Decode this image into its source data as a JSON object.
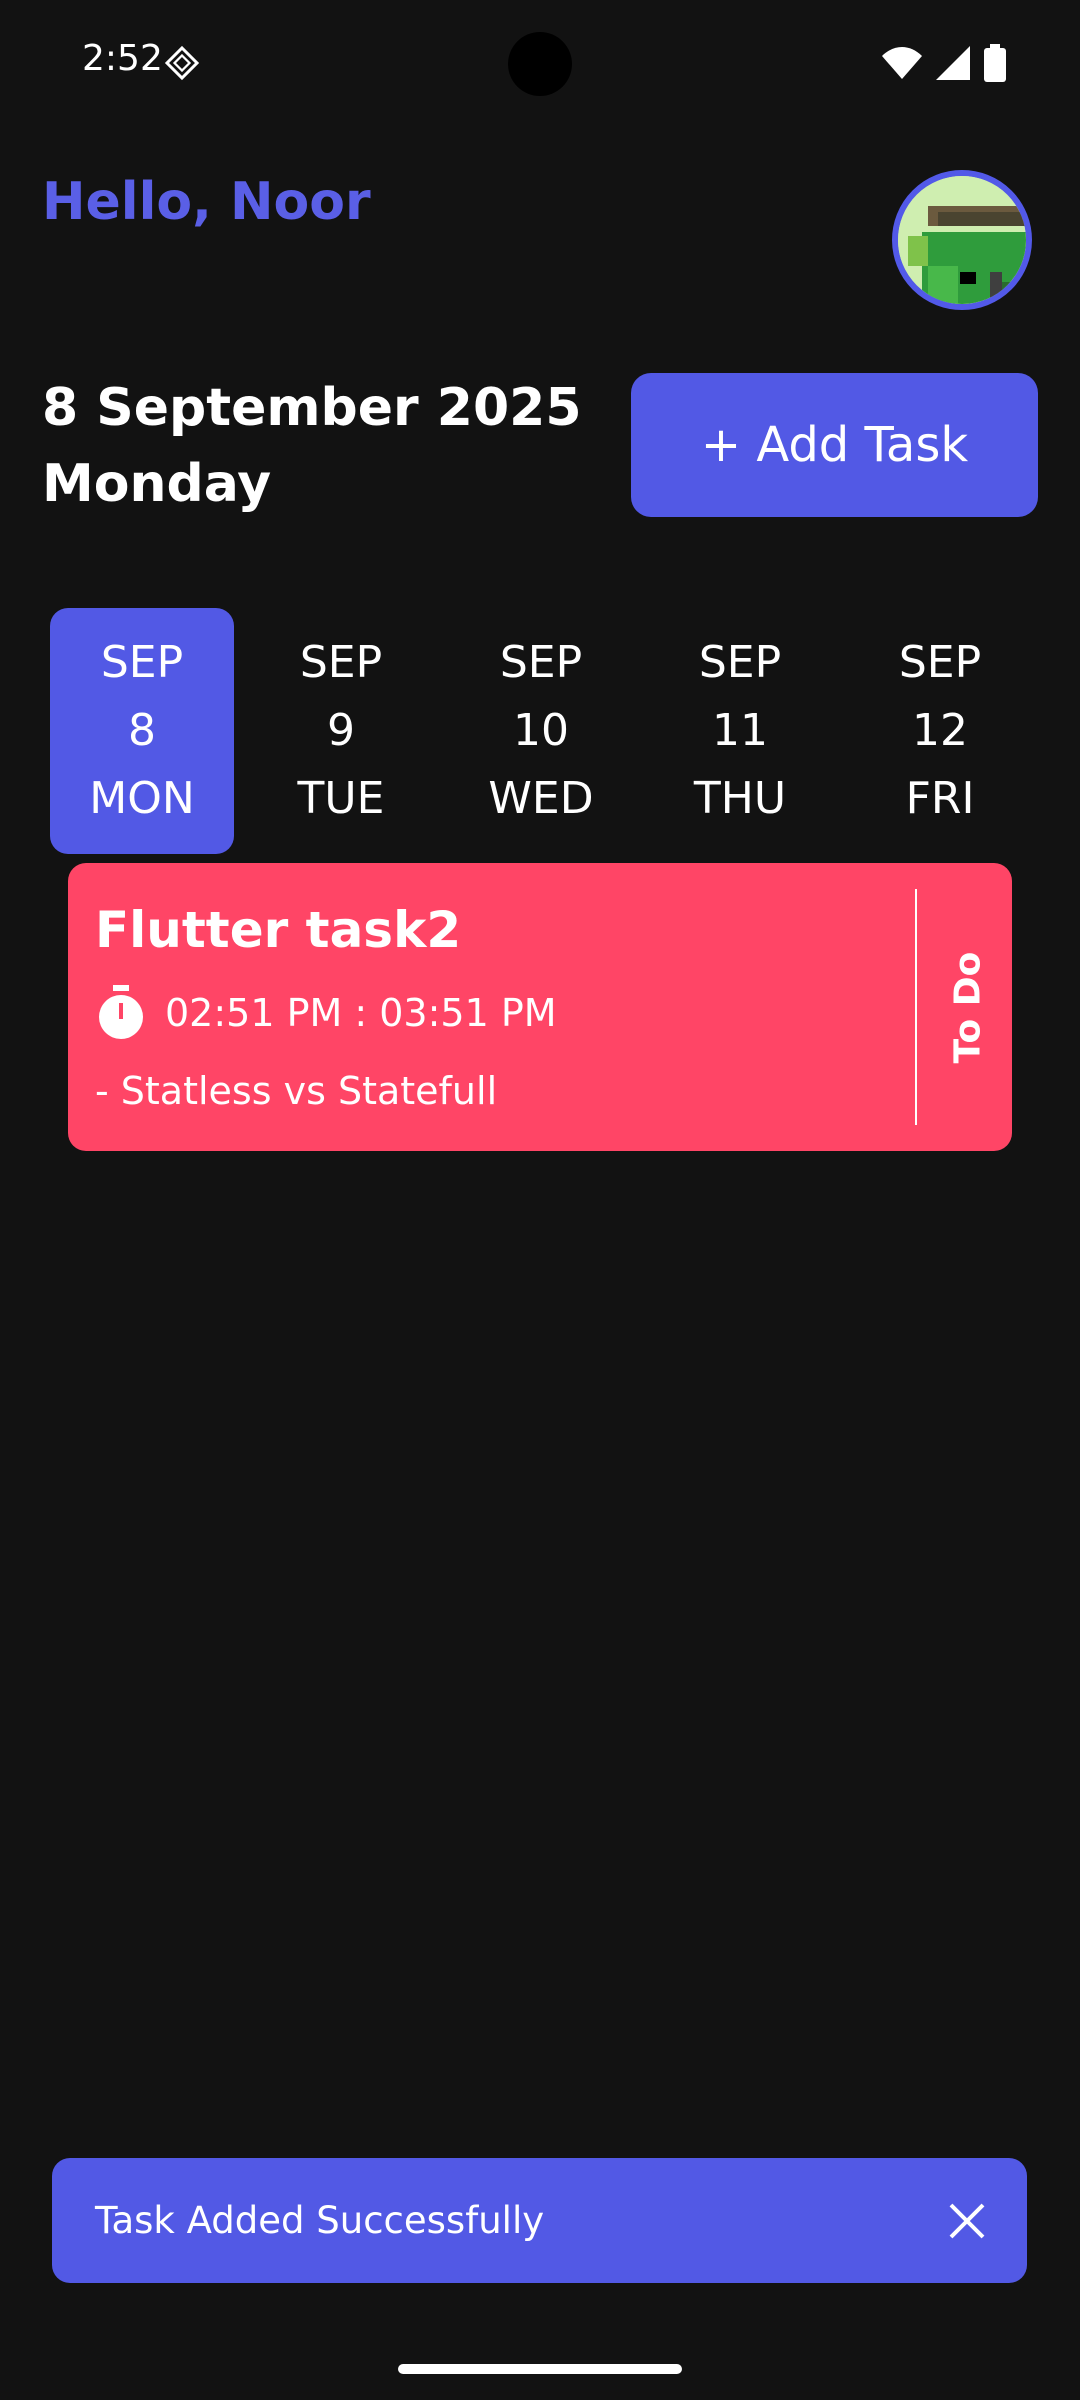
{
  "status_bar": {
    "time": "2:52",
    "icons": [
      "settings-sparkle-icon",
      "wifi-icon",
      "signal-icon",
      "battery-icon"
    ]
  },
  "header": {
    "greeting": "Hello, Noor",
    "avatar_icon": "pixel-art-avatar"
  },
  "date_block": {
    "date": "8 September 2025",
    "weekday": "Monday"
  },
  "add_task_button": {
    "label": "+ Add Task"
  },
  "date_strip": [
    {
      "month": "SEP",
      "day": "8",
      "weekday": "MON",
      "selected": true
    },
    {
      "month": "SEP",
      "day": "9",
      "weekday": "TUE",
      "selected": false
    },
    {
      "month": "SEP",
      "day": "10",
      "weekday": "WED",
      "selected": false
    },
    {
      "month": "SEP",
      "day": "11",
      "weekday": "THU",
      "selected": false
    },
    {
      "month": "SEP",
      "day": "12",
      "weekday": "FRI",
      "selected": false
    }
  ],
  "tasks": [
    {
      "title": "Flutter task2",
      "time": "02:51 PM : 03:51 PM",
      "note": "- Statless vs Statefull",
      "status": "To Do",
      "color": "#ff4566"
    }
  ],
  "snackbar": {
    "message": "Task Added Successfully",
    "close_icon": "close-icon"
  },
  "colors": {
    "background": "#121212",
    "accent": "#5259e5",
    "greeting": "#5a5fe6",
    "task_red": "#ff4566"
  }
}
